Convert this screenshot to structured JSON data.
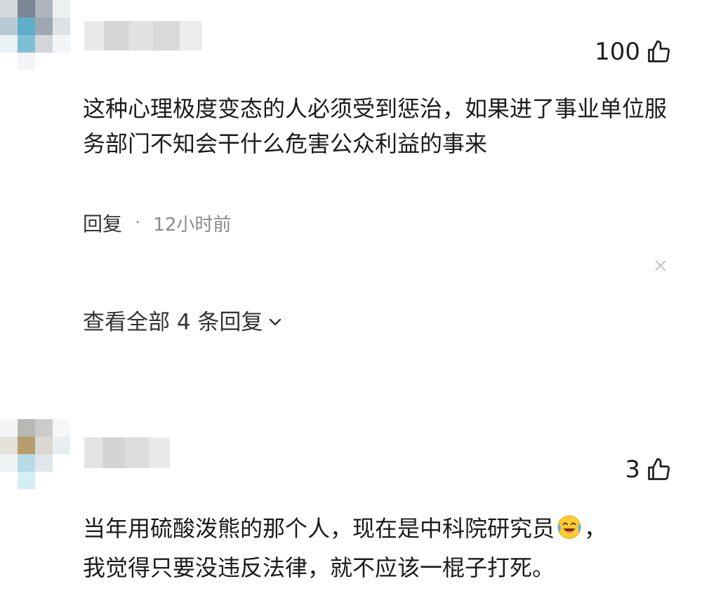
{
  "comments": [
    {
      "likes": "100",
      "text": "这种心理极度变态的人必须受到惩治，如果进了事业单位服务部门不知会干什么危害公众利益的事来",
      "reply_label": "回复",
      "separator": "·",
      "time": "12小时前",
      "view_replies_label": "查看全部 4 条回复"
    },
    {
      "likes": "3",
      "text_line1_a": "当年用硫酸泼熊的那个人，现在是中科院研究员",
      "text_line1_b": "，",
      "text_line2": "我觉得只要没违反法律，就不应该一棍子打死。",
      "emoji": "laughing-crying-emoji"
    }
  ],
  "icons": {
    "like": "thumbs-up-icon",
    "close": "close-icon",
    "chevron": "chevron-down-icon"
  },
  "colors": {
    "text": "#1b1b1b",
    "meta": "#8a8a8a",
    "avatar_blue": "#5eaec6",
    "avatar_tan": "#b79d6e"
  }
}
